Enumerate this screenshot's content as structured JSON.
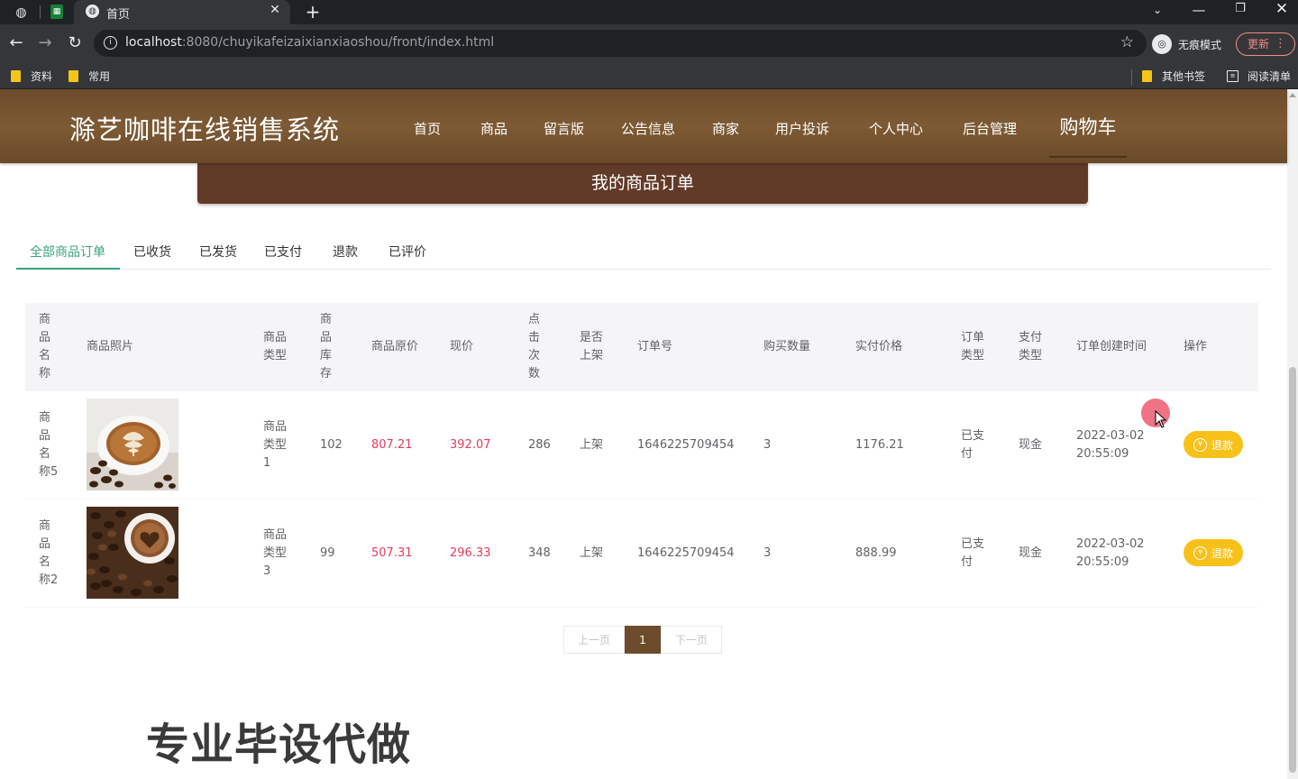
{
  "browser": {
    "tab_title": "首页",
    "url_host": "localhost",
    "url_path": ":8080/chuyikafeizaixianxiaoshou/front/index.html",
    "incognito_label": "无痕模式",
    "update_label": "更新",
    "bookmarks": [
      "资料",
      "常用"
    ],
    "bookmarks_right": [
      "其他书签",
      "阅读清单"
    ]
  },
  "site": {
    "title": "滁艺咖啡在线销售系统",
    "nav": [
      "首页",
      "商品",
      "留言版",
      "公告信息",
      "商家",
      "用户投诉",
      "个人中心",
      "后台管理"
    ],
    "cart": "购物车"
  },
  "banner": "我的商品订单",
  "tabs": [
    "全部商品订单",
    "已收货",
    "已发货",
    "已支付",
    "退款",
    "已评价"
  ],
  "table": {
    "headers": {
      "name": "商\n品\n名\n称",
      "photo": "商品照片",
      "type": "商品\n类型",
      "stock": "商\n品\n库\n存",
      "orig_price": "商品原价",
      "price": "现价",
      "clicks": "点\n击\n次\n数",
      "listed": "是否\n上架",
      "order_no": "订单号",
      "qty": "购买数量",
      "paid": "实付价格",
      "order_type": "订单\n类型",
      "pay_type": "支付\n类型",
      "created": "订单创建时间",
      "action": "操作"
    },
    "rows": [
      {
        "name": "商\n品\n名\n称5",
        "type": "商品\n类型\n1",
        "stock": "102",
        "orig_price": "807.21",
        "price": "392.07",
        "clicks": "286",
        "listed": "上架",
        "order_no": "1646225709454",
        "qty": "3",
        "paid": "1176.21",
        "order_type": "已支\n付",
        "pay_type": "现金",
        "created": "2022-03-02\n20:55:09",
        "action": "退款"
      },
      {
        "name": "商\n品\n名\n称2",
        "type": "商品\n类型\n3",
        "stock": "99",
        "orig_price": "507.31",
        "price": "296.33",
        "clicks": "348",
        "listed": "上架",
        "order_no": "1646225709454",
        "qty": "3",
        "paid": "888.99",
        "order_type": "已支\n付",
        "pay_type": "现金",
        "created": "2022-03-02\n20:55:09",
        "action": "退款"
      }
    ]
  },
  "pagination": {
    "prev": "上一页",
    "current": "1",
    "next": "下一页"
  },
  "watermark": "专业毕设代做",
  "colors": {
    "header_brown": "#6d4c2b",
    "banner_brown": "#623a28",
    "active_green": "#3ba37a",
    "price_red": "#e33b5a",
    "refund_yellow": "#f8c11a"
  }
}
